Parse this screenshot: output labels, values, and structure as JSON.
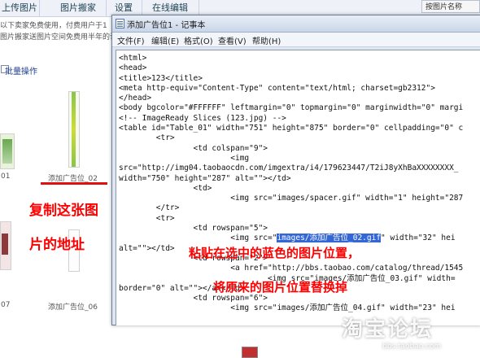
{
  "background_page": {
    "tabs": [
      "上传图片",
      "图片搬家",
      "设置",
      "在线编辑"
    ],
    "search_label": "按图片名称",
    "notice_line1": "以下卖家免费使用，付费用户于1",
    "notice_line2": "图片搬家送图片空间免费用半年的说",
    "batch_label": "批量操作",
    "captions": {
      "left1": "01",
      "thumb02": "添加广告位_02",
      "left2": "07",
      "thumb06": "添加广告位_06"
    }
  },
  "notes": {
    "copy_line1": "复制这张图",
    "copy_line2": "片的地址",
    "paste_line1": "粘贴在选中的蓝色的图片位置，",
    "paste_line2": "将原来的图片位置替换掉"
  },
  "notepad": {
    "title": "添加广告位1 - 记事本",
    "menu": [
      "文件(F)",
      "编辑(E)",
      "格式(O)",
      "查看(V)",
      "帮助(H)"
    ],
    "lines": [
      "<html>",
      "<head>",
      "<title>123</title>",
      "<meta http-equiv=\"Content-Type\" content=\"text/html; charset=gb2312\">",
      "</head>",
      "<body bgcolor=\"#FFFFFF\" leftmargin=\"0\" topmargin=\"0\" marginwidth=\"0\" margi",
      "<!-- ImageReady Slices (123.jpg) -->",
      "<table id=\"Table_01\" width=\"751\" height=\"875\" border=\"0\" cellpadding=\"0\" c",
      "        <tr>",
      "                <td colspan=\"9\">",
      "                        <img",
      "src=\"http://img04.taobaocdn.com/imgextra/i4/179623447/T2iJ8yXhBaXXXXXXXX_",
      "width=\"750\" height=\"287\" alt=\"\"></td>",
      "                <td>",
      "                        <img src=\"images/spacer.gif\" width=\"1\" height=\"287",
      "        </tr>",
      "        <tr>",
      "                <td rowspan=\"5\">",
      "                        <img src=\"images/添加广告位_02.gif\" width=\"32\" hei",
      "alt=\"\"></td>",
      "                <td rowspan=\"2\">",
      "                        <a href=\"http://bbs.taobao.com/catalog/thread/1545",
      "                                <img src=\"images/添加广告位_03.gif\" width=",
      "border=\"0\" alt=\"\"></a></td>",
      "                <td rowspan=\"6\">",
      "                        <img src=\"images/添加广告位_04.gif\" width=\"23\" hei"
    ],
    "highlight": {
      "line_index": 18,
      "text": "images/添加广告位_02.gif",
      "color": "#3367d6"
    }
  },
  "watermark": {
    "main": "淘宝论坛",
    "sub": "bbs.taobao.com"
  },
  "colors": {
    "annotation_red": "#ff0000",
    "selection_blue": "#3367d6"
  }
}
